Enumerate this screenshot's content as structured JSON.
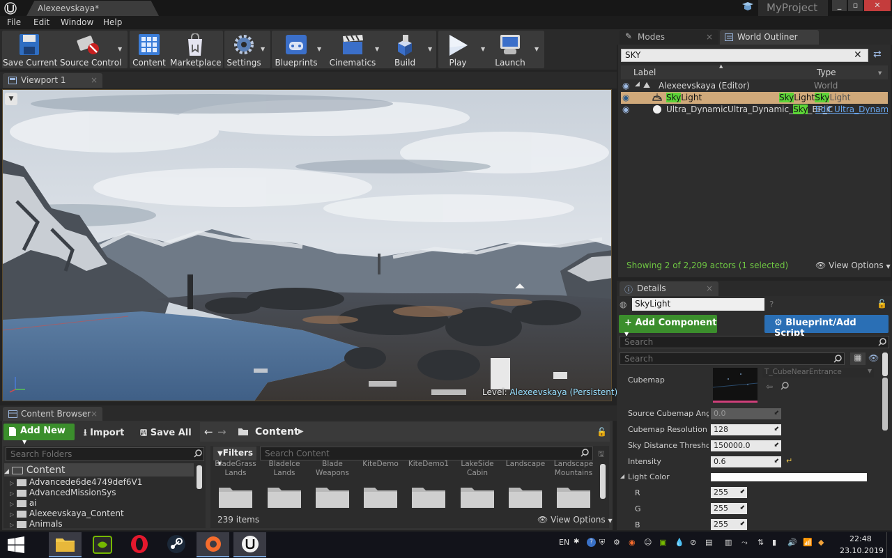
{
  "title_bar": {
    "doc_tab": "Alexeevskaya*",
    "project": "MyProject",
    "win_buttons": [
      "_",
      "▫",
      "✕"
    ]
  },
  "menu": [
    "File",
    "Edit",
    "Window",
    "Help"
  ],
  "toolbar": {
    "buttons": [
      {
        "label": "Save Current",
        "icon": "save-icon"
      },
      {
        "label": "Source Control",
        "icon": "source-control-icon"
      },
      {
        "label": "Content",
        "icon": "content-icon"
      },
      {
        "label": "Marketplace",
        "icon": "marketplace-icon"
      },
      {
        "label": "Settings",
        "icon": "settings-icon"
      },
      {
        "label": "Blueprints",
        "icon": "blueprints-icon"
      },
      {
        "label": "Cinematics",
        "icon": "cinematics-icon"
      },
      {
        "label": "Build",
        "icon": "build-icon"
      },
      {
        "label": "Play",
        "icon": "play-icon"
      },
      {
        "label": "Launch",
        "icon": "launch-icon"
      }
    ]
  },
  "viewport": {
    "tab": "Viewport 1",
    "level_label": "Level:",
    "level_name": "Alexeevskaya (Persistent)"
  },
  "content_browser": {
    "tab": "Content Browser",
    "add_new": "Add New",
    "import": "Import",
    "save_all": "Save All",
    "path": "Content",
    "search_folders_placeholder": "Search Folders",
    "filters": "Filters",
    "search_content_placeholder": "Search Content",
    "tree": [
      "Content",
      "Advancede6de4749def6V1",
      "AdvancedMissionSys",
      "ai",
      "Alexeevskaya_Content",
      "Animals"
    ],
    "assets": [
      [
        "BladeGrass",
        "Lands"
      ],
      [
        "BladeIce",
        "Lands"
      ],
      [
        "Blade",
        "Weapons"
      ],
      [
        "KiteDemo",
        ""
      ],
      [
        "KiteDemo1",
        ""
      ],
      [
        "LakeSide",
        "Cabin"
      ],
      [
        "Landscape",
        ""
      ],
      [
        "Landscape",
        "Mountains"
      ]
    ],
    "item_count": "239 items",
    "view_options": "View Options"
  },
  "modes_tab": "Modes",
  "world_outliner": {
    "tab": "World Outliner",
    "search_value": "SKY",
    "col_label": "Label",
    "col_type": "Type",
    "rows": [
      {
        "label": "Alexeevskaya (Editor)",
        "type": "World"
      },
      {
        "label_hl": "Sky",
        "label_rest": "Light",
        "type_hl1": "Sky",
        "type_mid": "Light",
        "type_hl2": "Sky",
        "type_rest": "Light"
      },
      {
        "label_pre": "Ultra_DynamicUltra_Dynamic_",
        "label_hl": "Sky",
        "label_rest": "_BP_C",
        "type": "Edit Ultra_Dynamic"
      }
    ],
    "status": "Showing 2 of 2,209 actors (1 selected)",
    "view_options": "View Options"
  },
  "details": {
    "tab": "Details",
    "name": "SkyLight",
    "add_component": "Add Component",
    "blueprint_script": "Blueprint/Add Script",
    "search_placeholder": "Search",
    "search2_placeholder": "Search",
    "cubemap_label": "Cubemap",
    "cubemap_asset": "T_CubeNearEntrance",
    "props": [
      {
        "label": "Source Cubemap Angle",
        "value": "0.0",
        "dim": true
      },
      {
        "label": "Cubemap Resolution",
        "value": "128",
        "dim": false
      },
      {
        "label": "Sky Distance Threshold",
        "value": "150000.0",
        "dim": false
      },
      {
        "label": "Intensity",
        "value": "0.6",
        "dim": false
      }
    ],
    "light_color_label": "Light Color",
    "rgb": [
      {
        "label": "R",
        "value": "255"
      },
      {
        "label": "G",
        "value": "255"
      },
      {
        "label": "B",
        "value": "255"
      }
    ]
  },
  "taskbar": {
    "lang": "EN",
    "time": "22:48",
    "date": "23.10.2019"
  },
  "colors": {
    "accent_green": "#3b8e2c",
    "accent_blue": "#2a6fb5",
    "search_highlight": "#5cd437",
    "selected_row": "#d0a97a"
  }
}
